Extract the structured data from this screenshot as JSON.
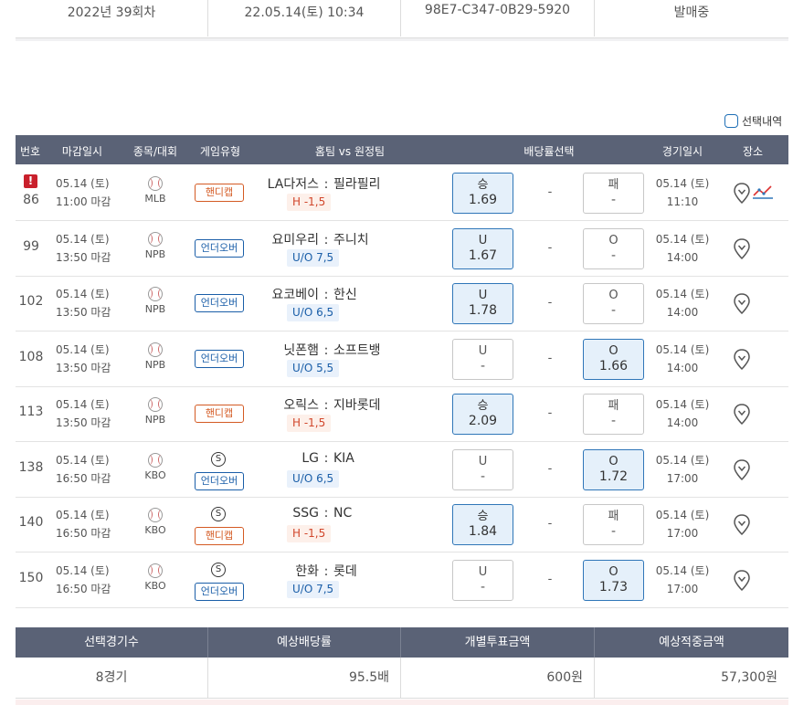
{
  "slip": {
    "round": "2022년 39회차",
    "datetime": "22.05.14(토) 10:34",
    "code": "98E7-C347-0B29-5920",
    "status": "발매중"
  },
  "select_toggle": "선택내역",
  "headers": [
    "번호",
    "마감일시",
    "종목/대회",
    "게임유형",
    "홈팀 vs 원정팀",
    "배당률선택",
    "경기일시",
    "장소"
  ],
  "rows": [
    {
      "num": "86",
      "warn": "!",
      "deadline_date": "05.14 (토)",
      "deadline_time": "11:00 마감",
      "league": "MLB",
      "special": "",
      "type": "핸디캡",
      "type_kind": "hd",
      "home": "LA다저스",
      "sep": ":",
      "away": "필라필리",
      "line": "H -1,5",
      "a_label": "승",
      "a_value": "1.69",
      "a_selected": true,
      "draw": "-",
      "b_label": "패",
      "b_value": "-",
      "b_selected": false,
      "game_date": "05.14 (토)",
      "game_time": "11:10",
      "trend": true
    },
    {
      "num": "99",
      "warn": "",
      "deadline_date": "05.14 (토)",
      "deadline_time": "13:50 마감",
      "league": "NPB",
      "special": "",
      "type": "언더오버",
      "type_kind": "uo",
      "home": "요미우리",
      "sep": ":",
      "away": "주니치",
      "line": "U/O 7,5",
      "a_label": "U",
      "a_value": "1.67",
      "a_selected": true,
      "draw": "-",
      "b_label": "O",
      "b_value": "-",
      "b_selected": false,
      "game_date": "05.14 (토)",
      "game_time": "14:00",
      "trend": false
    },
    {
      "num": "102",
      "warn": "",
      "deadline_date": "05.14 (토)",
      "deadline_time": "13:50 마감",
      "league": "NPB",
      "special": "",
      "type": "언더오버",
      "type_kind": "uo",
      "home": "요코베이",
      "sep": ":",
      "away": "한신",
      "line": "U/O 6,5",
      "a_label": "U",
      "a_value": "1.78",
      "a_selected": true,
      "draw": "-",
      "b_label": "O",
      "b_value": "-",
      "b_selected": false,
      "game_date": "05.14 (토)",
      "game_time": "14:00",
      "trend": false
    },
    {
      "num": "108",
      "warn": "",
      "deadline_date": "05.14 (토)",
      "deadline_time": "13:50 마감",
      "league": "NPB",
      "special": "",
      "type": "언더오버",
      "type_kind": "uo",
      "home": "닛폰햄",
      "sep": ":",
      "away": "소프트뱅",
      "line": "U/O 5,5",
      "a_label": "U",
      "a_value": "-",
      "a_selected": false,
      "draw": "-",
      "b_label": "O",
      "b_value": "1.66",
      "b_selected": true,
      "game_date": "05.14 (토)",
      "game_time": "14:00",
      "trend": false
    },
    {
      "num": "113",
      "warn": "",
      "deadline_date": "05.14 (토)",
      "deadline_time": "13:50 마감",
      "league": "NPB",
      "special": "",
      "type": "핸디캡",
      "type_kind": "hd",
      "home": "오릭스",
      "sep": ":",
      "away": "지바롯데",
      "line": "H -1,5",
      "a_label": "승",
      "a_value": "2.09",
      "a_selected": true,
      "draw": "-",
      "b_label": "패",
      "b_value": "-",
      "b_selected": false,
      "game_date": "05.14 (토)",
      "game_time": "14:00",
      "trend": false
    },
    {
      "num": "138",
      "warn": "",
      "deadline_date": "05.14 (토)",
      "deadline_time": "16:50 마감",
      "league": "KBO",
      "special": "S",
      "type": "언더오버",
      "type_kind": "uo",
      "home": "LG",
      "sep": ":",
      "away": "KIA",
      "line": "U/O 6,5",
      "a_label": "U",
      "a_value": "-",
      "a_selected": false,
      "draw": "-",
      "b_label": "O",
      "b_value": "1.72",
      "b_selected": true,
      "game_date": "05.14 (토)",
      "game_time": "17:00",
      "trend": false
    },
    {
      "num": "140",
      "warn": "",
      "deadline_date": "05.14 (토)",
      "deadline_time": "16:50 마감",
      "league": "KBO",
      "special": "S",
      "type": "핸디캡",
      "type_kind": "hd",
      "home": "SSG",
      "sep": ":",
      "away": "NC",
      "line": "H -1,5",
      "a_label": "승",
      "a_value": "1.84",
      "a_selected": true,
      "draw": "-",
      "b_label": "패",
      "b_value": "-",
      "b_selected": false,
      "game_date": "05.14 (토)",
      "game_time": "17:00",
      "trend": false
    },
    {
      "num": "150",
      "warn": "",
      "deadline_date": "05.14 (토)",
      "deadline_time": "16:50 마감",
      "league": "KBO",
      "special": "S",
      "type": "언더오버",
      "type_kind": "uo",
      "home": "한화",
      "sep": ":",
      "away": "롯데",
      "line": "U/O 7,5",
      "a_label": "U",
      "a_value": "-",
      "a_selected": false,
      "draw": "-",
      "b_label": "O",
      "b_value": "1.73",
      "b_selected": true,
      "game_date": "05.14 (토)",
      "game_time": "17:00",
      "trend": false
    }
  ],
  "summary": {
    "headers": [
      "선택경기수",
      "예상배당률",
      "개별투표금액",
      "예상적중금액"
    ],
    "values": [
      "8경기",
      "95.5배",
      "600원",
      "57,300원"
    ]
  },
  "colors": {
    "header_bg": "#5a6276",
    "selected_bg": "#e5f0fa",
    "selected_border": "#2f76b8",
    "handicap": "#d45a23",
    "underover": "#1a5ea8",
    "warning": "#c9202c"
  }
}
